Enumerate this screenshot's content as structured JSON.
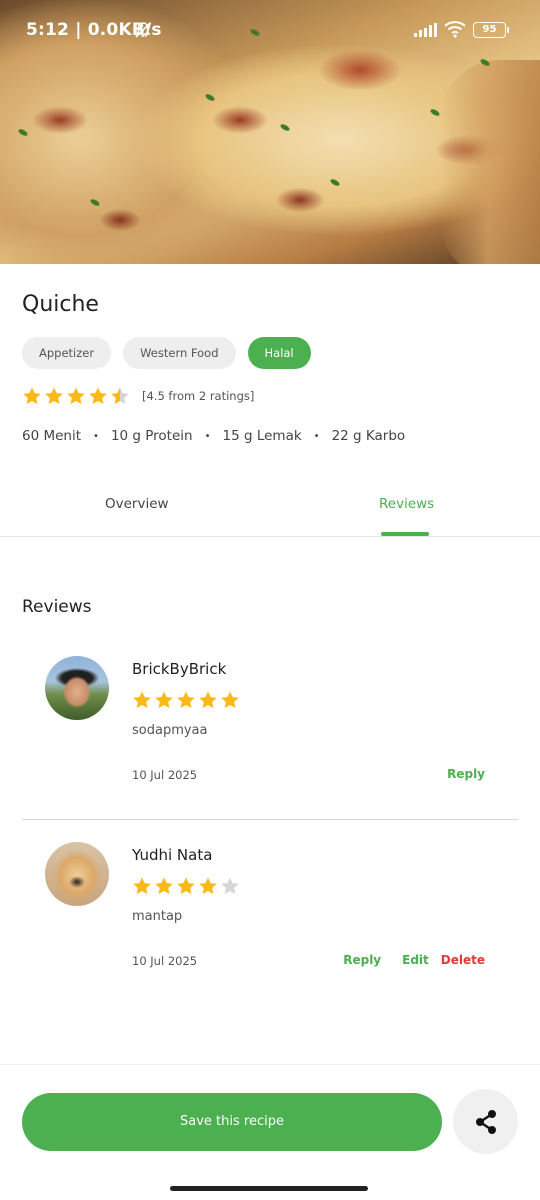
{
  "status_bar": {
    "time": "5:12 | 0.0KB/s",
    "battery": "95"
  },
  "recipe": {
    "title": "Quiche",
    "tags": [
      {
        "label": "Appetizer",
        "active": false
      },
      {
        "label": "Western Food",
        "active": false
      },
      {
        "label": "Halal",
        "active": true
      }
    ],
    "rating_value": 4.5,
    "rating_text": "[4.5 from 2 ratings]",
    "meta": [
      "60 Menit",
      "10 g Protein",
      "15 g Lemak",
      "22 g Karbo"
    ],
    "meta_separator": "•"
  },
  "tabs": {
    "overview": "Overview",
    "reviews": "Reviews",
    "active": "reviews"
  },
  "reviews": {
    "title": "Reviews",
    "items": [
      {
        "name": "BrickByBrick",
        "stars": 5,
        "comment": "sodapmyaa",
        "date": "10 Jul 2025",
        "reply": "Reply"
      },
      {
        "name": "Yudhi Nata",
        "stars": 4,
        "comment": "mantap",
        "date": "10 Jul 2025",
        "reply": "Reply",
        "edit": "Edit",
        "delete": "Delete"
      }
    ]
  },
  "footer": {
    "save_label": "Save this recipe"
  },
  "colors": {
    "accent": "#4caf50",
    "star": "#f9b916",
    "star_empty": "#d6d6d6",
    "delete": "#e53935"
  }
}
